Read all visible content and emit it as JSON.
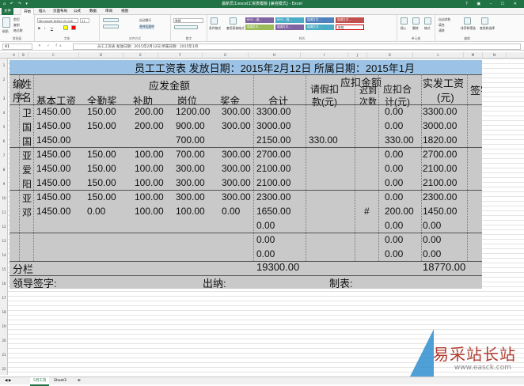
{
  "titlebar": {
    "quick_access": "⌂ ↶ ↷ ▾",
    "title": "最新员工excel工资表模板 [兼容模式] - Excel",
    "window_controls": "? ▣ – ☐ ✕"
  },
  "menubar": {
    "file": "文件",
    "tabs": [
      "开始",
      "插入",
      "页面布局",
      "公式",
      "数据",
      "审阅",
      "视图"
    ],
    "active": "开始"
  },
  "ribbon": {
    "clipboard": {
      "paste": "粘贴",
      "cut": "剪切",
      "copy": "复制",
      "format_painter": "格式刷",
      "label": "剪贴板"
    },
    "font": {
      "name": "Microsoft YaHei UI Ligh",
      "size": "11",
      "label": "字体",
      "bold": "B",
      "italic": "I",
      "underline": "U"
    },
    "align": {
      "wrap": "自动换行",
      "merge": "合并后居中",
      "label": "对齐方式"
    },
    "number": {
      "format": "常规",
      "label": "数字"
    },
    "styles": {
      "conditional": "条件格式",
      "table": "套用表格格式",
      "label": "样式",
      "items": [
        {
          "text": "60% - 强...",
          "color": "#8064a2"
        },
        {
          "text": "60% - 强...",
          "color": "#4bacc6"
        },
        {
          "text": "强调文字...",
          "color": "#4f81bd"
        },
        {
          "text": "强调文字...",
          "color": "#c0504d"
        },
        {
          "text": "强调文字...",
          "color": "#9bbb59"
        },
        {
          "text": "强调文字...",
          "color": "#8064a2"
        },
        {
          "text": "强调文字...",
          "color": "#4bacc6"
        },
        {
          "text": "常规",
          "color": "#ffffff"
        }
      ]
    },
    "cells": {
      "insert": "插入",
      "delete": "删除",
      "format": "格式",
      "label": "单元格"
    },
    "editing": {
      "autosum": "自动求和",
      "fill": "填充",
      "clear": "清除",
      "sort": "排序和筛选",
      "find": "查找和选择",
      "label": "编辑"
    }
  },
  "formula_bar": {
    "name_box": "A1",
    "fx": "✕ ✓ fx",
    "content": "员工工资表    发放日期：2015年2月12日 所属日期：2015年1月"
  },
  "columns": [
    "A",
    "B",
    "C",
    "D",
    "E",
    "F",
    "G",
    "H",
    "I",
    "J",
    "K",
    "L",
    "M",
    "N"
  ],
  "rows": [
    "1",
    "2",
    "3",
    "4",
    "5",
    "6",
    "7",
    "8",
    "9",
    "10",
    "11",
    "12",
    "13",
    "14",
    "15",
    "16",
    "17",
    "18",
    "19",
    "20",
    "21",
    "22",
    "23",
    "24",
    "25"
  ],
  "sheet": {
    "title": "员工工资表     发放日期：2015年2月12日  所属日期：2015年1月",
    "headers": {
      "seq_a": "编",
      "seq_b": "序",
      "name_a": "姓",
      "name_b": "名",
      "payable": "应发金额",
      "deduct": "应扣金额",
      "actual_a": "实发工资",
      "actual_b": "(元)",
      "sign": "签字",
      "base": "基本工资",
      "attend": "全勤奖",
      "subsidy": "补助",
      "post": "岗位",
      "bonus": "奖金",
      "total": "合计",
      "leave_a": "请假扣",
      "leave_b": "款(元)",
      "other_a": "迟到",
      "other_b": "次数",
      "ded_total_a": "应扣合",
      "ded_total_b": "计(元)"
    },
    "rows": [
      {
        "name": "卫",
        "base": "1450.00",
        "attend": "150.00",
        "subsidy": "200.00",
        "post": "1200.00",
        "bonus": "300.00",
        "total": "3300.00",
        "leave": "",
        "other": "",
        "ded": "0.00",
        "actual": "3300.00"
      },
      {
        "name": "国",
        "base": "1450.00",
        "attend": "150.00",
        "subsidy": "200.00",
        "post": "900.00",
        "bonus": "300.00",
        "total": "3000.00",
        "leave": "",
        "other": "",
        "ded": "0.00",
        "actual": "3000.00"
      },
      {
        "name": "国",
        "base": "1450.00",
        "attend": "",
        "subsidy": "",
        "post": "700.00",
        "bonus": "",
        "total": "2150.00",
        "leave": "330.00",
        "other": "",
        "ded": "330.00",
        "actual": "1820.00"
      },
      {
        "name": "亚",
        "base": "1450.00",
        "attend": "150.00",
        "subsidy": "100.00",
        "post": "700.00",
        "bonus": "300.00",
        "total": "2700.00",
        "leave": "",
        "other": "",
        "ded": "0.00",
        "actual": "2700.00"
      },
      {
        "name": "爱",
        "base": "1450.00",
        "attend": "150.00",
        "subsidy": "100.00",
        "post": "300.00",
        "bonus": "300.00",
        "total": "2100.00",
        "leave": "",
        "other": "",
        "ded": "0.00",
        "actual": "2100.00"
      },
      {
        "name": "阳",
        "base": "1450.00",
        "attend": "150.00",
        "subsidy": "100.00",
        "post": "300.00",
        "bonus": "300.00",
        "total": "2100.00",
        "leave": "",
        "other": "",
        "ded": "0.00",
        "actual": "2100.00"
      },
      {
        "name": "亚",
        "base": "1450.00",
        "attend": "150.00",
        "subsidy": "100.00",
        "post": "300.00",
        "bonus": "300.00",
        "total": "2300.00",
        "leave": "",
        "other": "",
        "ded": "0.00",
        "actual": "2300.00"
      },
      {
        "name": "邓",
        "base": "1450.00",
        "attend": "0.00",
        "subsidy": "100.00",
        "post": "100.00",
        "bonus": "0.00",
        "total": "1650.00",
        "leave": "",
        "other": "#",
        "ded": "200.00",
        "actual": "1450.00"
      },
      {
        "name": "",
        "base": "",
        "attend": "",
        "subsidy": "",
        "post": "",
        "bonus": "",
        "total": "0.00",
        "leave": "",
        "other": "",
        "ded": "0.00",
        "actual": "0.00"
      },
      {
        "name": "",
        "base": "",
        "attend": "",
        "subsidy": "",
        "post": "",
        "bonus": "",
        "total": "0.00",
        "leave": "",
        "other": "",
        "ded": "0.00",
        "actual": "0.00"
      },
      {
        "name": "",
        "base": "",
        "attend": "",
        "subsidy": "",
        "post": "",
        "bonus": "",
        "total": "0.00",
        "leave": "",
        "other": "",
        "ded": "0.00",
        "actual": "0.00"
      }
    ],
    "subtotal_label": "分栏",
    "subtotal_total": "19300.00",
    "subtotal_actual": "18770.00",
    "leader_sign": "领导签字:",
    "cashier": "出纳:",
    "maker": "制表:"
  },
  "sheet_tabs": {
    "nav": "◀ ▶",
    "active": "5月工资",
    "other": "Sheet3",
    "add": "⊕"
  },
  "watermark": {
    "cn": "易采站长站",
    "url": "www.easck.com"
  }
}
